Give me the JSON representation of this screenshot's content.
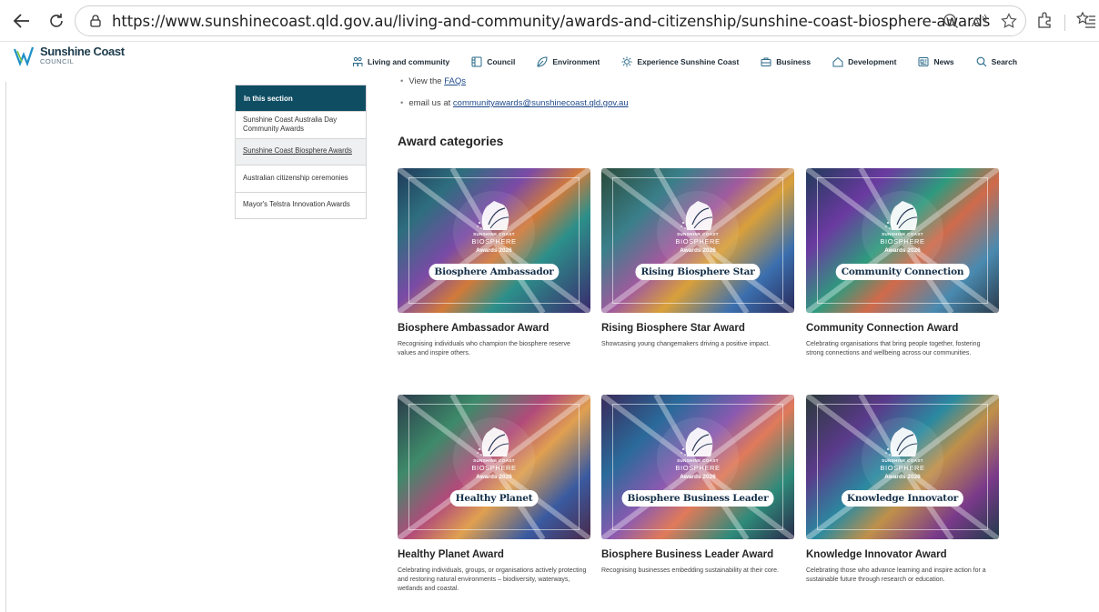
{
  "browser": {
    "url": "https://www.sunshinecoast.qld.gov.au/living-and-community/awards-and-citizenship/sunshine-coast-biosphere-awards"
  },
  "site": {
    "logo_name": "Sunshine Coast",
    "logo_sub": "COUNCIL",
    "nav": [
      {
        "label": "Living and community",
        "icon": "people-icon"
      },
      {
        "label": "Council",
        "icon": "building-icon"
      },
      {
        "label": "Environment",
        "icon": "leaf-icon"
      },
      {
        "label": "Experience Sunshine Coast",
        "icon": "sun-icon"
      },
      {
        "label": "Business",
        "icon": "briefcase-icon"
      },
      {
        "label": "Development",
        "icon": "house-icon"
      },
      {
        "label": "News",
        "icon": "newspaper-icon"
      },
      {
        "label": "Search",
        "icon": "search-icon"
      }
    ]
  },
  "section_nav": {
    "heading": "In this section",
    "items": [
      {
        "label": "Sunshine Coast Australia Day Community Awards",
        "active": false
      },
      {
        "label": "Sunshine Coast Biosphere Awards",
        "active": true
      },
      {
        "label": "Australian citizenship ceremonies",
        "active": false
      },
      {
        "label": "Mayor's Telstra Innovation Awards",
        "active": false
      }
    ]
  },
  "content": {
    "bullet1_prefix": "View the ",
    "bullet1_link": "FAQs",
    "bullet2_prefix": "email us at ",
    "bullet2_link": "communityawards@sunshinecoast.qld.gov.au",
    "categories_heading": "Award categories",
    "emblem": {
      "line1": "SUNSHINE COAST",
      "line2": "BIOSPHERE",
      "line3": "Awards 2026"
    },
    "cards": [
      {
        "pill": "Biosphere Ambassador",
        "title": "Biosphere Ambassador Award",
        "desc": "Recognising individuals who champion the biosphere reserve values and inspire others."
      },
      {
        "pill": "Rising Biosphere Star",
        "title": "Rising Biosphere Star Award",
        "desc": "Showcasing young changemakers driving a positive impact."
      },
      {
        "pill": "Community Connection",
        "title": "Community Connection Award",
        "desc": "Celebrating organisations that bring people together, fostering strong connections and wellbeing across our communities."
      },
      {
        "pill": "Healthy Planet",
        "title": "Healthy Planet Award",
        "desc": "Celebrating individuals, groups, or organisations actively protecting and restoring natural environments – biodiversity, waterways, wetlands and coastal."
      },
      {
        "pill": "Biosphere Business Leader",
        "title": "Biosphere Business Leader Award",
        "desc": "Recognising businesses embedding sustainability at their core."
      },
      {
        "pill": "Knowledge Innovator",
        "title": "Knowledge Innovator Award",
        "desc": "Celebrating those who advance learning and inspire action for a sustainable future through research or education."
      }
    ]
  },
  "colors": {
    "section_head": "#0f4d63",
    "link": "#1f4a8a",
    "logo_blue": "#1c3c4c"
  }
}
